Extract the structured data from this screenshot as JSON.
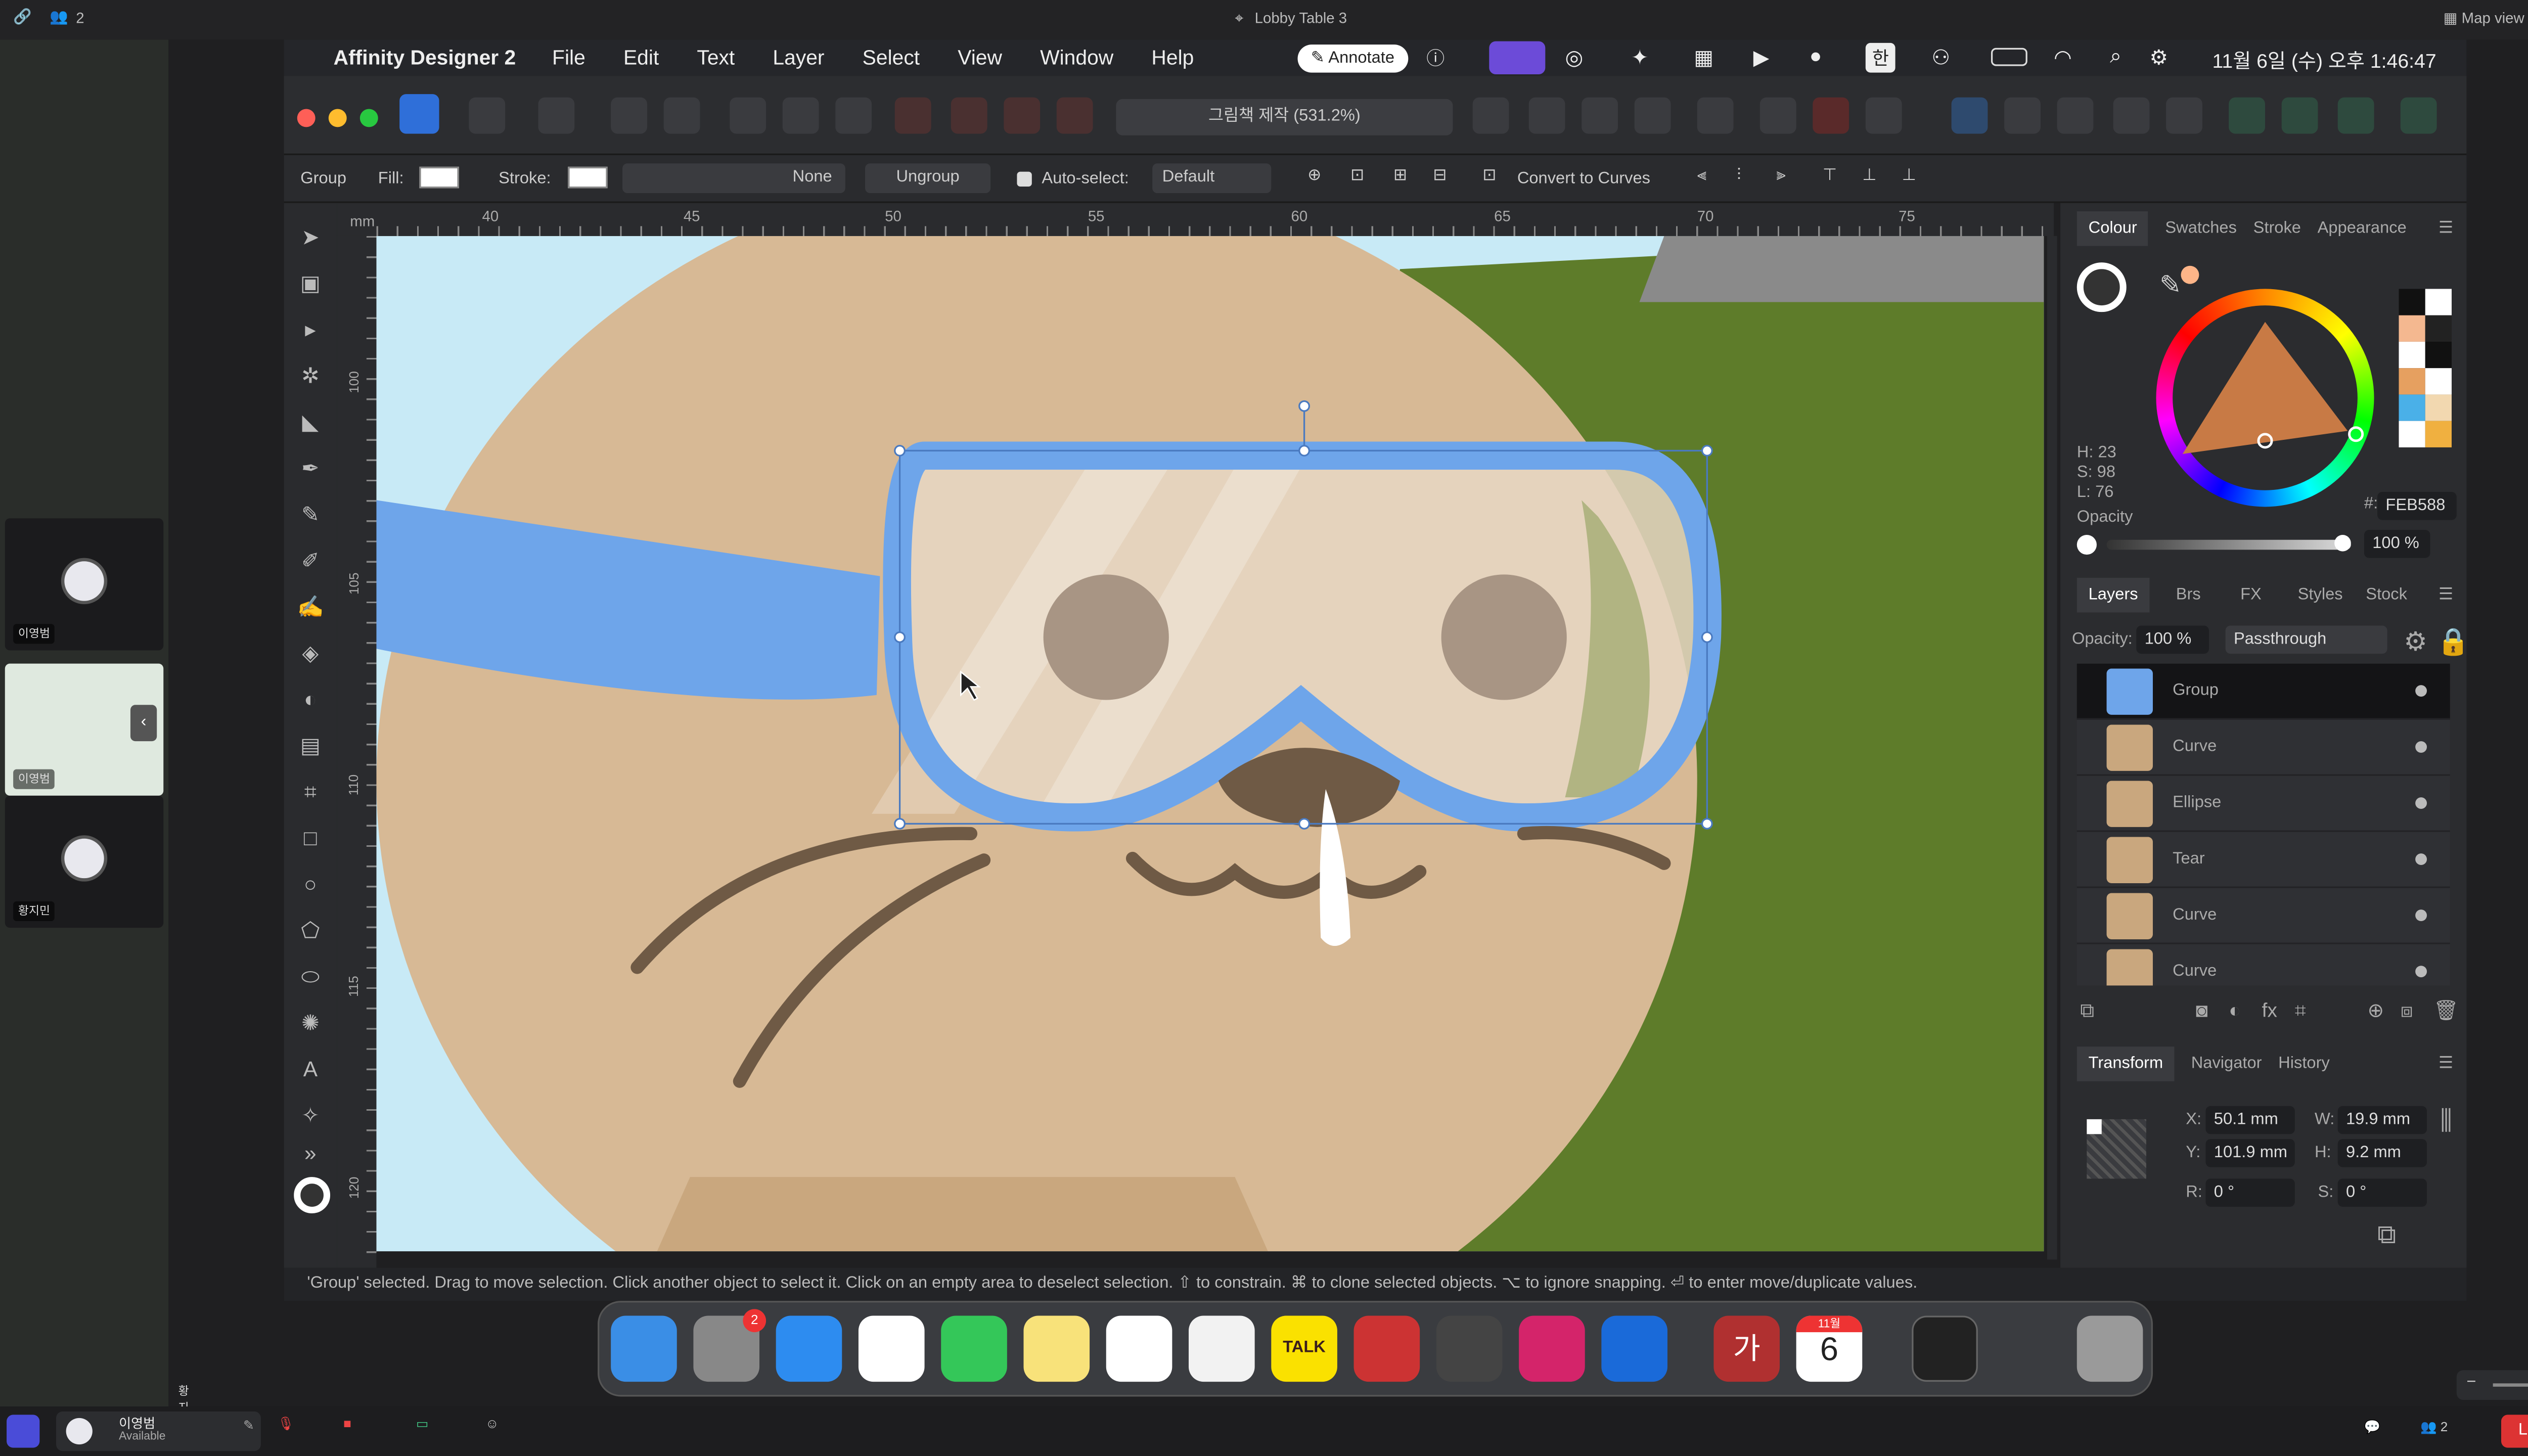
{
  "meeting": {
    "title": "Lobby Table 3",
    "participants": "2",
    "map_view": "Map view",
    "tile1_name": "이영범",
    "tile2_name": "이영범",
    "tile3_name": "황지민",
    "bottom_name": "황지민",
    "user_name": "이영범",
    "user_status": "Available",
    "people_count": "2",
    "leave": "Leave"
  },
  "menubar": {
    "app": "Affinity Designer 2",
    "items": [
      "File",
      "Edit",
      "Text",
      "Layer",
      "Select",
      "View",
      "Window",
      "Help"
    ],
    "annotate": "Annotate",
    "ime": "한",
    "datetime": "11월 6일 (수) 오후 1:46:47"
  },
  "toolbar": {
    "document_title": "그림책 제작 (531.2%)"
  },
  "context": {
    "selection": "Group",
    "fill_label": "Fill:",
    "stroke_label": "Stroke:",
    "stroke_none": "None",
    "ungroup": "Ungroup",
    "autoselect": "Auto-select:",
    "autoselect_value": "Default",
    "convert": "Convert to Curves"
  },
  "ruler": {
    "unit": "mm",
    "top_ticks": [
      "40",
      "45",
      "50",
      "55",
      "60",
      "65",
      "70",
      "75"
    ],
    "left_ticks": [
      "100",
      "105",
      "110",
      "115",
      "120"
    ]
  },
  "colour_panel": {
    "tabs": [
      "Colour",
      "Swatches",
      "Stroke",
      "Appearance"
    ],
    "h": "H: 23",
    "s": "S: 98",
    "l": "L: 76",
    "hex_label": "#:",
    "hex": "FEB588",
    "opacity_label": "Opacity",
    "opacity": "100 %",
    "swatches": [
      "#111111",
      "#ffffff",
      "#f4b890",
      "#222222",
      "#ffffff",
      "#111111",
      "#e6a060",
      "#ffffff",
      "#4ab0e8",
      "#f2d8b0",
      "#ffffff",
      "#f0b040"
    ]
  },
  "layers_panel": {
    "tabs": [
      "Layers",
      "Brs",
      "FX",
      "Styles",
      "Stock"
    ],
    "opacity_label": "Opacity:",
    "opacity": "100 %",
    "blend": "Passthrough",
    "layers": [
      "Group",
      "Curve",
      "Ellipse",
      "Tear",
      "Curve",
      "Curve"
    ]
  },
  "transform_panel": {
    "tabs": [
      "Transform",
      "Navigator",
      "History"
    ],
    "x_label": "X:",
    "x": "50.1 mm",
    "w_label": "W:",
    "w": "19.9 mm",
    "y_label": "Y:",
    "y": "101.9 mm",
    "h_label": "H:",
    "h": "9.2 mm",
    "r_label": "R:",
    "r": "0 °",
    "s_label": "S:",
    "s": "0 °"
  },
  "status": {
    "text": "'Group' selected. Drag to move selection. Click another object to select it. Click on an empty area to deselect selection. ⇧ to constrain. ⌘ to clone selected objects. ⌥ to ignore snapping. ⏎ to enter move/duplicate values."
  },
  "dock": {
    "settings_badge": "2",
    "kalk": "TALK",
    "ga": "가",
    "cal_month": "11월",
    "cal_day": "6"
  }
}
